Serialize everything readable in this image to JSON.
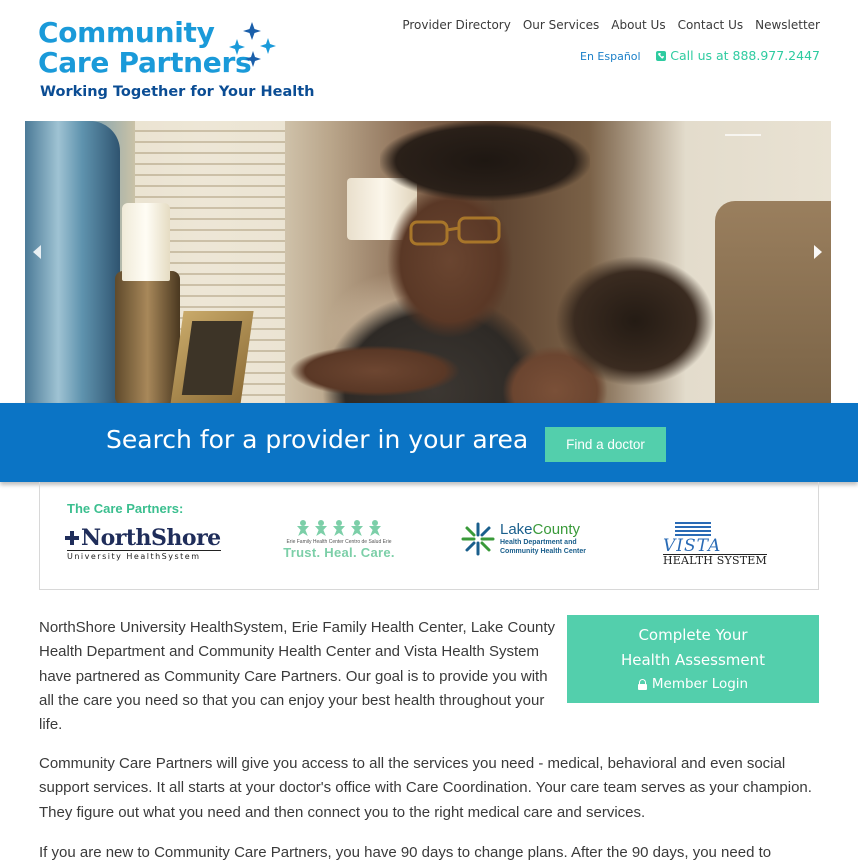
{
  "header": {
    "logo_line1": "Community",
    "logo_line2": "Care Partners",
    "tagline": "Working Together for Your Health",
    "nav": [
      "Provider Directory",
      "Our Services",
      "About Us",
      "Contact Us",
      "Newsletter"
    ],
    "espanol": "En Español",
    "call": "Call us at 888.977.2447"
  },
  "hero": {
    "prev_icon": "chevron-left-icon",
    "next_icon": "chevron-right-icon"
  },
  "search": {
    "heading": "Search for a provider in your area",
    "button": "Find a doctor"
  },
  "partners": {
    "title": "The Care Partners:",
    "northshore": {
      "name": "NorthShore",
      "sub": "University HealthSystem"
    },
    "erie": {
      "small": "Erie Family Health Center   Centro de Salud Erie",
      "main": "Trust. Heal. Care."
    },
    "lakecounty": {
      "name_a": "Lake",
      "name_b": "County",
      "sub1": "Health Department and",
      "sub2": "Community Health Center"
    },
    "vista": {
      "name": "VISTA",
      "sub": "HEALTH SYSTEM"
    }
  },
  "assessment": {
    "line1": "Complete Your",
    "line2": "Health Assessment",
    "login": "Member Login"
  },
  "body": {
    "p1": "NorthShore University HealthSystem, Erie Family Health Center, Lake County Health Department and Community Health Center and Vista Health System have partnered as Community Care Partners. Our goal is to provide you with all the care you need so that you can enjoy your best health throughout your life.",
    "p2": "Community Care Partners will give you access to all the services you need - medical, behavioral and even social support services. It all starts at your doctor's office with Care Coordination. Your care team serves as your champion. They figure out what you need and then connect you to the right medical care and services.",
    "p3": "If you are new to Community Care Partners, you have 90 days to change plans. After the 90 days, you need to"
  },
  "colors": {
    "brand_blue": "#1a9ad9",
    "navy": "#0b4d94",
    "band_blue": "#0b74c5",
    "accent_green": "#53cfac"
  }
}
